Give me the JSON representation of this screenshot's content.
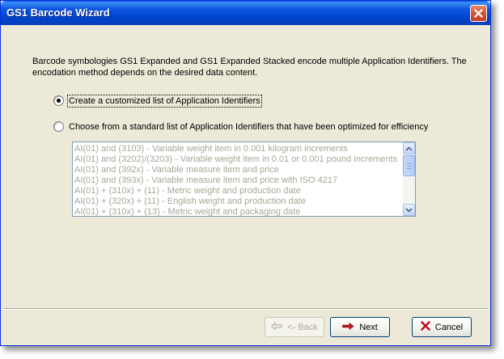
{
  "window": {
    "title": "GS1 Barcode Wizard"
  },
  "intro_text": "Barcode symbologies GS1 Expanded and GS1 Expanded Stacked encode multiple Application Identifiers.  The encodation method depends on the desired data content.",
  "options": {
    "custom": {
      "label": "Create a customized list of Application Identifiers",
      "selected": true
    },
    "standard": {
      "label": "Choose from a standard list of Application Identifiers that have been optimized for efficiency",
      "selected": false
    }
  },
  "standard_list": {
    "items": [
      "AI(01) and (3103) - Variable weight item in 0.001 kilogram increments",
      "AI(01) and (3202)/(3203) - Variable weight item in 0.01 or 0.001 pound increments",
      "AI(01) and (392x) - Variable measure item and price",
      "AI(01) and (393x) - Variable measure item and price with ISO 4217",
      "AI(01) + (310x) + (11) - Metric weight and production date",
      "AI(01) + (320x) + (11) - English weight and production date",
      "AI(01) + (310x) + (13) - Metric weight and packaging date"
    ],
    "enabled": false
  },
  "buttons": {
    "back": "<- Back",
    "next": "Next",
    "cancel": "Cancel"
  },
  "icons": {
    "close": "close-icon",
    "back": "back-arrow-icon",
    "next": "next-arrow-icon",
    "cancel": "cancel-x-icon"
  },
  "colors": {
    "titlebar": "#0a54e0",
    "dialog_bg": "#ece9d8",
    "disabled_text": "#a7a697",
    "accent_red": "#c1121f"
  }
}
